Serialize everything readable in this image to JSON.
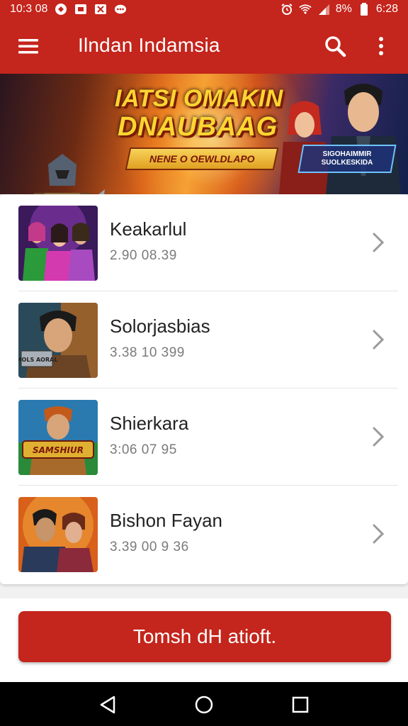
{
  "status_bar": {
    "time_left": "10:3 08",
    "battery": "8%",
    "clock_right": "6:28"
  },
  "app_bar": {
    "title": "Ilndan Indamsia"
  },
  "banner": {
    "headline_line1": "IATSI OMAKIN",
    "headline_line2": "DNAUBAAG",
    "ribbon": "NENE O OEWLDLAPO",
    "tag": "SIGOHAIMMIR SUOLKESKIDA"
  },
  "list": [
    {
      "title": "Keakarlul",
      "subtitle": "2.90 08.39"
    },
    {
      "title": "Solorjasbias",
      "subtitle": "3.38 10 399"
    },
    {
      "title": "Shierkara",
      "subtitle": "3:06 07 95"
    },
    {
      "title": "Bishon Fayan",
      "subtitle": "3.39 00 9 36"
    }
  ],
  "thumb_labels": {
    "item2": "MOLS AORAL",
    "item3": "SAMSHIUR"
  },
  "cta": {
    "label": "Tomsh dH atioft."
  },
  "colors": {
    "primary": "#c4251c",
    "nav": "#000000"
  }
}
